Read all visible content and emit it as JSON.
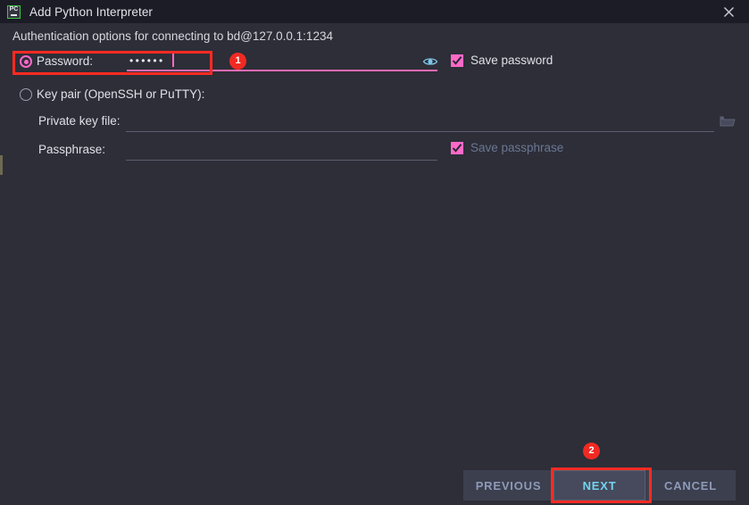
{
  "window": {
    "title": "Add Python Interpreter",
    "app_icon": "pycharm-icon",
    "app_icon_text": "PC",
    "close_icon": "close-icon"
  },
  "dialog": {
    "subtitle": "Authentication options for connecting to bd@127.0.0.1:1234"
  },
  "auth": {
    "password_option": {
      "label": "Password:",
      "selected": true,
      "value": "••••••",
      "masked_char_count": 6,
      "reveal_icon": "eye-icon",
      "save_checkbox": {
        "label": "Save password",
        "checked": true
      }
    },
    "keypair_option": {
      "label": "Key pair (OpenSSH or PuTTY):",
      "selected": false,
      "private_key_file": {
        "label": "Private key file:",
        "value": "",
        "browse_icon": "folder-icon"
      },
      "passphrase": {
        "label": "Passphrase:",
        "value": ""
      },
      "save_passphrase_checkbox": {
        "label": "Save passphrase",
        "checked": true,
        "enabled": false
      }
    }
  },
  "buttons": {
    "previous": "PREVIOUS",
    "next": "NEXT",
    "cancel": "CANCEL"
  },
  "annotations": {
    "badge_1": "1",
    "badge_2": "2"
  },
  "colors": {
    "background": "#2d2e38",
    "titlebar": "#1c1c26",
    "accent_pink": "#ff69c8",
    "annotation_red": "#fc2b23",
    "next_text": "#72d4f0",
    "disabled_text": "#6b7793"
  }
}
